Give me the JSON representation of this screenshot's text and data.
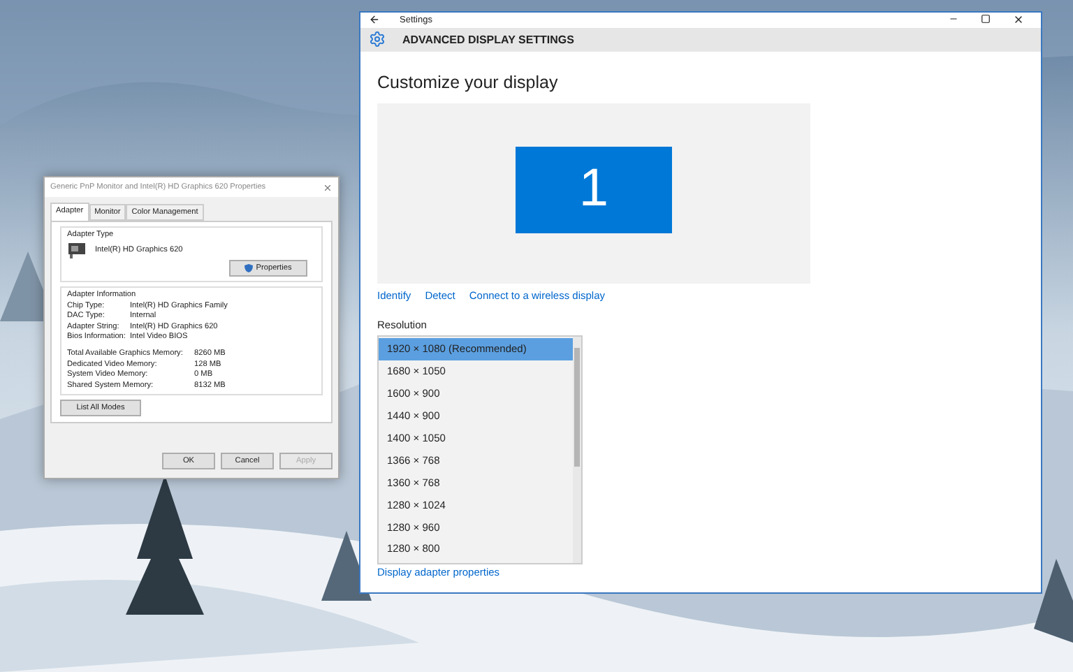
{
  "properties_dialog": {
    "title": "Generic PnP Monitor and Intel(R) HD Graphics 620 Properties",
    "tabs": [
      {
        "label": "Adapter",
        "selected": true
      },
      {
        "label": "Monitor",
        "selected": false
      },
      {
        "label": "Color Management",
        "selected": false
      }
    ],
    "adapter_type": {
      "heading": "Adapter Type",
      "name": "Intel(R) HD Graphics 620",
      "button": "Properties"
    },
    "adapter_information": {
      "heading": "Adapter Information",
      "fields": [
        {
          "label": "Chip Type:",
          "value": "Intel(R) HD Graphics Family"
        },
        {
          "label": "DAC Type:",
          "value": "Internal"
        },
        {
          "label": "Adapter String:",
          "value": "Intel(R) HD Graphics 620"
        },
        {
          "label": "Bios Information:",
          "value": "Intel Video BIOS"
        }
      ],
      "memory": [
        {
          "label": "Total Available Graphics Memory:",
          "value": "8260 MB"
        },
        {
          "label": "Dedicated Video Memory:",
          "value": "128 MB"
        },
        {
          "label": "System Video Memory:",
          "value": "0 MB"
        },
        {
          "label": "Shared System Memory:",
          "value": "8132 MB"
        }
      ]
    },
    "list_all_modes_button": "List All Modes",
    "buttons": [
      {
        "label": "OK",
        "disabled": false
      },
      {
        "label": "Cancel",
        "disabled": false
      },
      {
        "label": "Apply",
        "disabled": true
      }
    ]
  },
  "settings_window": {
    "title": "Settings",
    "header": "ADVANCED DISPLAY SETTINGS",
    "heading": "Customize your display",
    "monitor_label": "1",
    "links": [
      "Identify",
      "Detect",
      "Connect to a wireless display"
    ],
    "resolution": {
      "label": "Resolution",
      "options": [
        {
          "label": "1920 × 1080 (Recommended)",
          "selected": true
        },
        {
          "label": "1680 × 1050",
          "selected": false
        },
        {
          "label": "1600 × 900",
          "selected": false
        },
        {
          "label": "1440 × 900",
          "selected": false
        },
        {
          "label": "1400 × 1050",
          "selected": false
        },
        {
          "label": "1366 × 768",
          "selected": false
        },
        {
          "label": "1360 × 768",
          "selected": false
        },
        {
          "label": "1280 × 1024",
          "selected": false
        },
        {
          "label": "1280 × 960",
          "selected": false
        },
        {
          "label": "1280 × 800",
          "selected": false
        }
      ]
    },
    "footer_link": "Display adapter properties"
  }
}
